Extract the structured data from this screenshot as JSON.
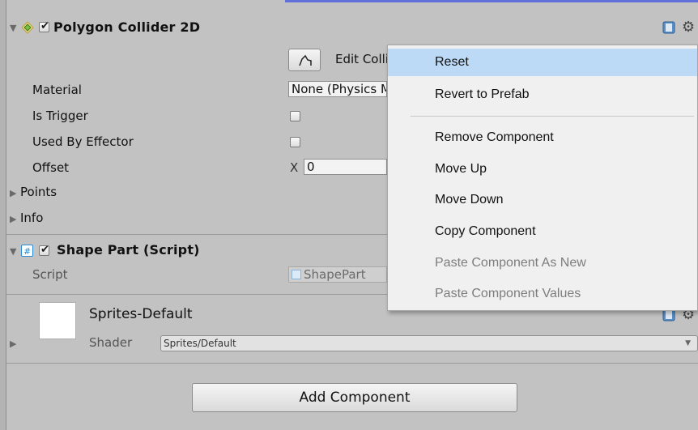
{
  "polygon_collider": {
    "title": "Polygon Collider 2D",
    "edit_collider_label": "Edit Collider",
    "properties": [
      {
        "label": "Material",
        "value": "None (Physics Material 2D)"
      },
      {
        "label": "Is Trigger"
      },
      {
        "label": "Used By Effector"
      },
      {
        "label": "Offset",
        "axis": "X",
        "value": "0"
      }
    ],
    "foldouts": [
      {
        "label": "Points"
      },
      {
        "label": "Info"
      }
    ]
  },
  "shape_part": {
    "title": "Shape Part (Script)",
    "script_label": "Script",
    "script_value": "ShapePart"
  },
  "material": {
    "name": "Sprites-Default",
    "shader_label": "Shader",
    "shader_value": "Sprites/Default"
  },
  "add_component_label": "Add Component",
  "context_menu": {
    "items": [
      {
        "label": "Reset",
        "state": "highlighted"
      },
      {
        "label": "Revert to Prefab",
        "state": "normal"
      },
      {
        "label": "Remove Component",
        "state": "normal"
      },
      {
        "label": "Move Up",
        "state": "normal"
      },
      {
        "label": "Move Down",
        "state": "normal"
      },
      {
        "label": "Copy Component",
        "state": "normal"
      },
      {
        "label": "Paste Component As New",
        "state": "disabled"
      },
      {
        "label": "Paste Component Values",
        "state": "disabled"
      }
    ]
  },
  "colors": {
    "panel_bg": "#c2c2c2",
    "menu_bg": "#f0f0f0",
    "menu_highlight": "#bcd9f5",
    "collider_icon": "#7bc043",
    "script_icon": "#2a8cd6"
  }
}
